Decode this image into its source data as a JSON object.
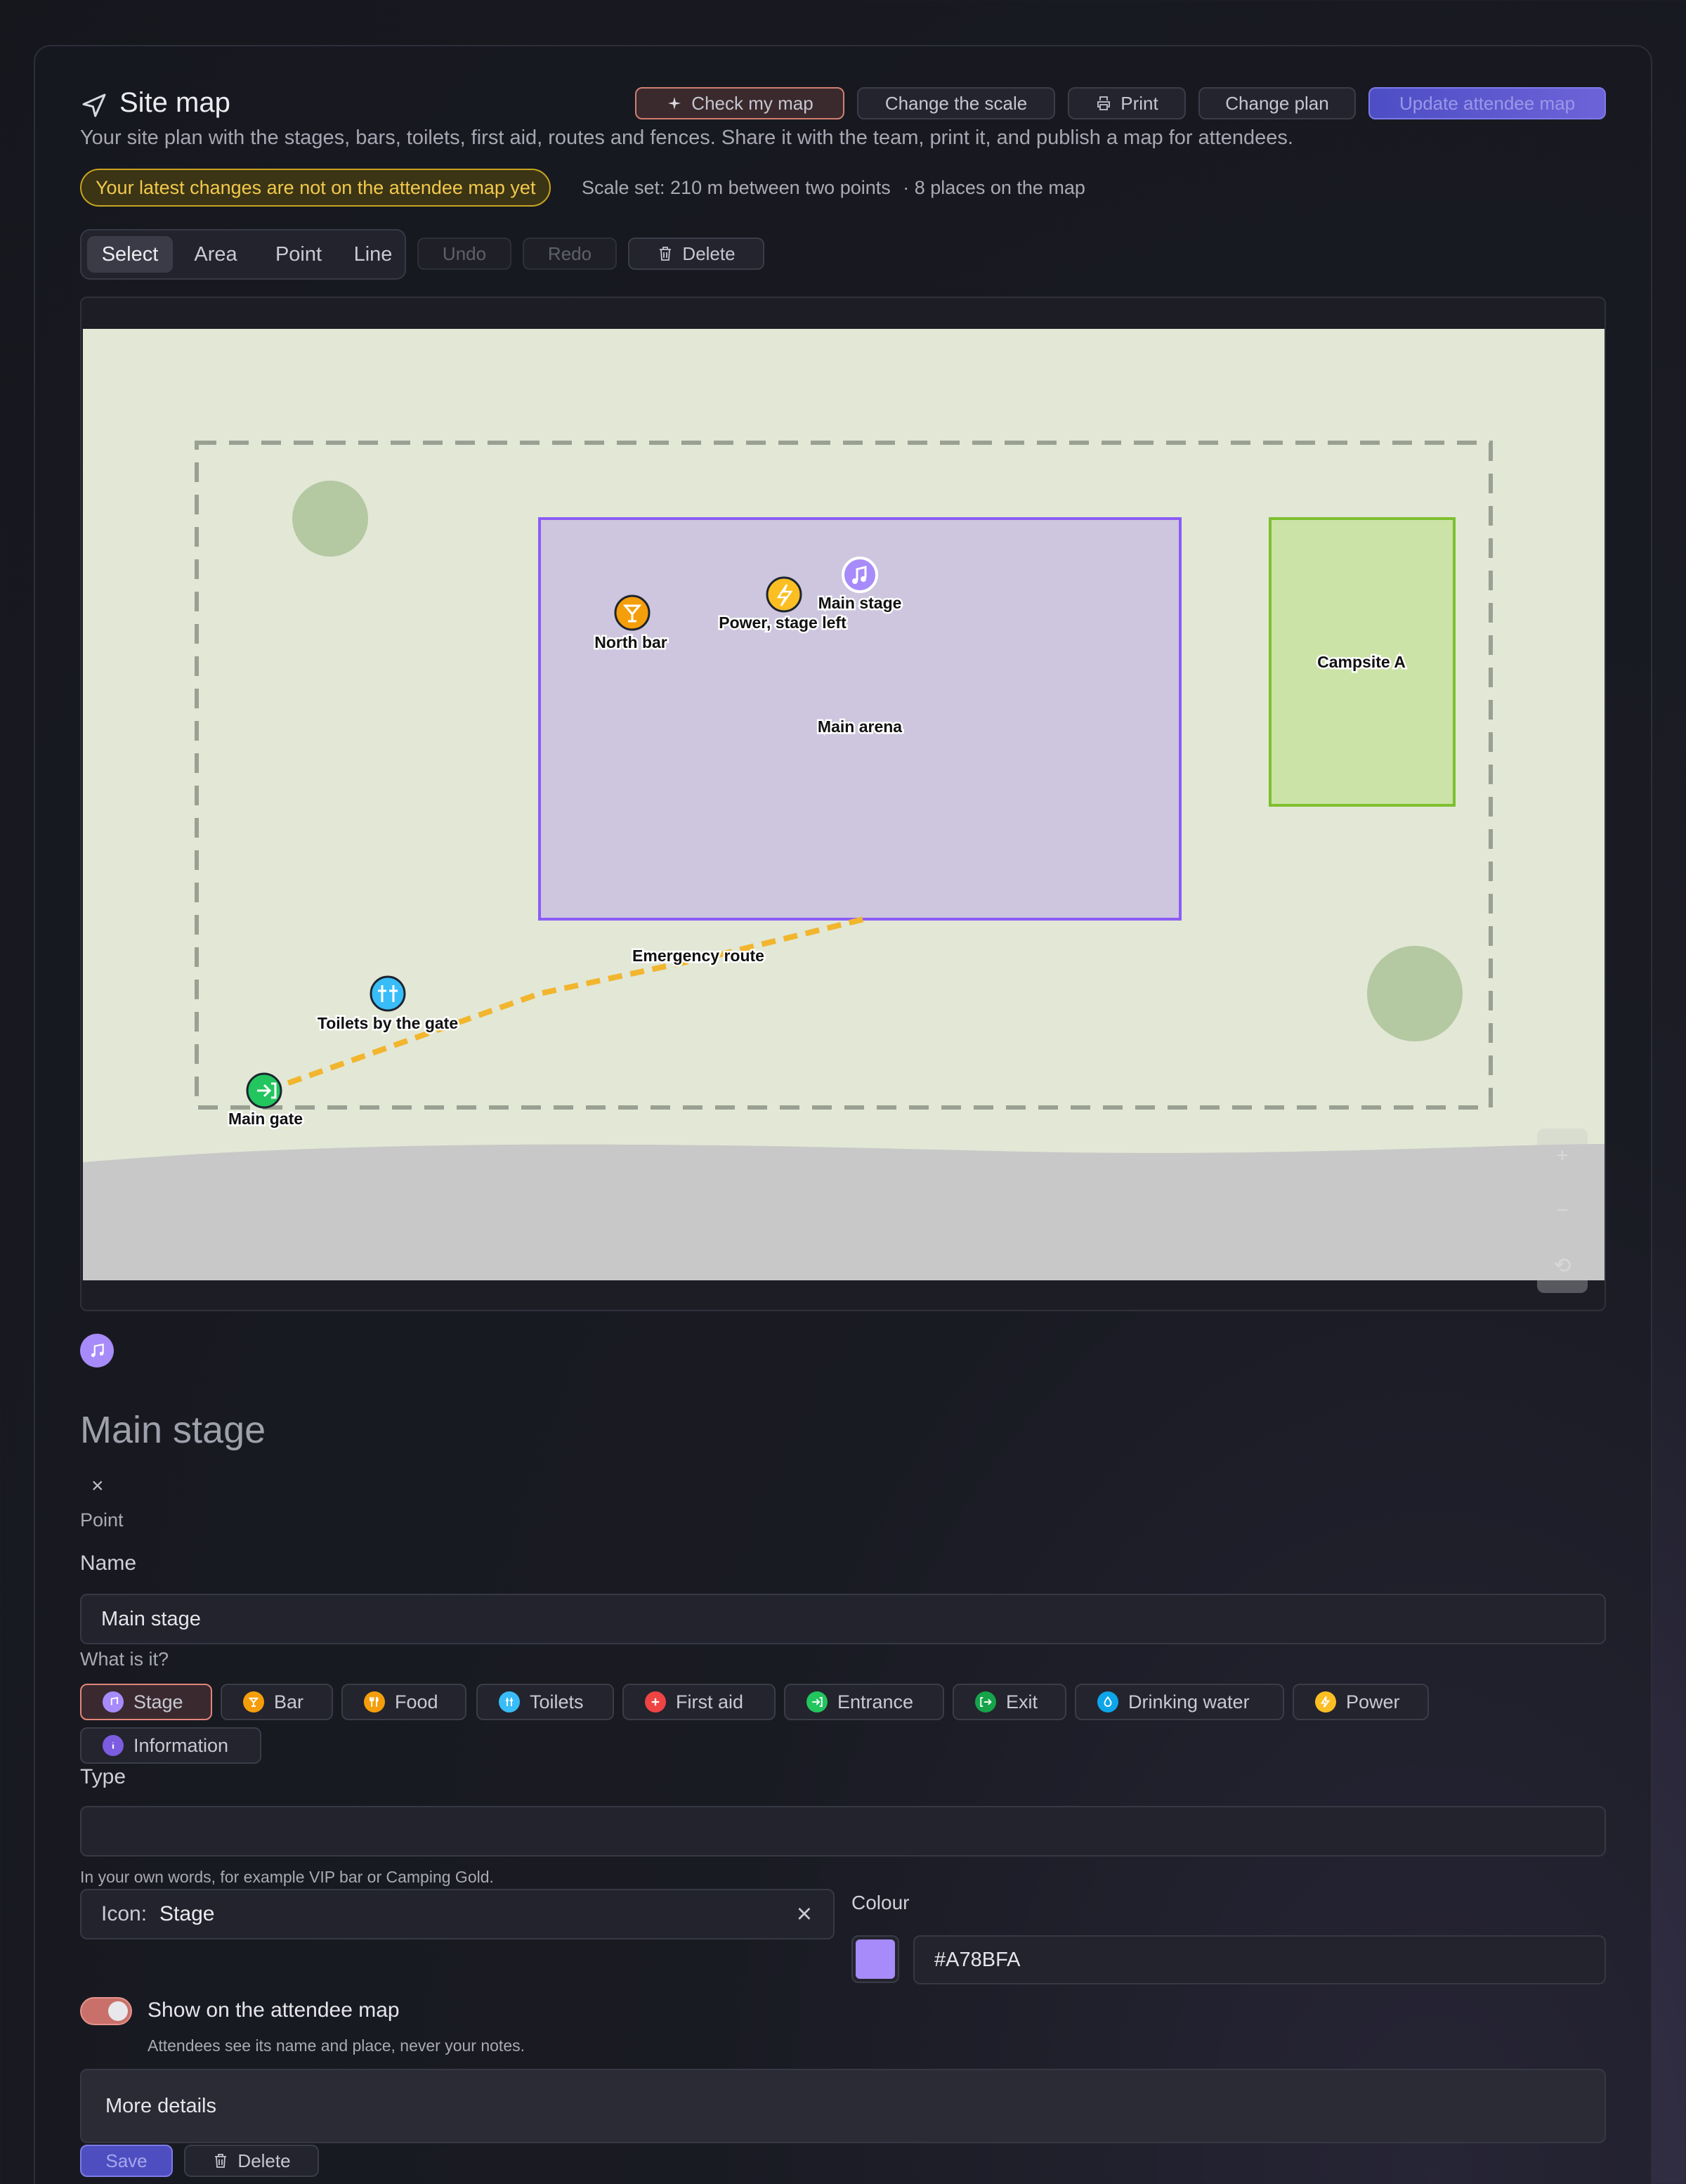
{
  "header": {
    "title": "Site map",
    "subtitle": "Your site plan with the stages, bars, toilets, first aid, routes and fences. Share it with the team, print it, and publish a map for attendees.",
    "buttons": {
      "check": "Check my map",
      "scale": "Change the scale",
      "print": "Print",
      "plan": "Change plan",
      "update": "Update attendee map"
    }
  },
  "status": {
    "badge": "Your latest changes are not on the attendee map yet",
    "scale": "Scale set: 210 m between two points",
    "places": "· 8 places on the map"
  },
  "toolbar": {
    "modes": [
      "Select",
      "Area",
      "Point",
      "Line"
    ],
    "active_mode": "Select",
    "undo": "Undo",
    "redo": "Redo",
    "delete": "Delete"
  },
  "map": {
    "places": {
      "main_arena": "Main arena",
      "campsite": "Campsite A",
      "north_bar": "North bar",
      "power": "Power, stage left",
      "main_stage": "Main stage",
      "emergency_route": "Emergency route",
      "toilets": "Toilets by the gate",
      "main_gate": "Main gate"
    },
    "zoom": {
      "in": "+",
      "out": "−",
      "reset": "⟲"
    }
  },
  "detail": {
    "title": "Main stage",
    "close": "×",
    "kind": "Point",
    "name_label": "Name",
    "name_value": "Main stage",
    "what_label": "What is it?",
    "types": [
      {
        "label": "Stage",
        "color": "#A78BFA",
        "icon": "music-icon"
      },
      {
        "label": "Bar",
        "color": "#F59E0B",
        "icon": "cocktail-icon"
      },
      {
        "label": "Food",
        "color": "#F59E0B",
        "icon": "fork-knife-icon"
      },
      {
        "label": "Toilets",
        "color": "#38BDF8",
        "icon": "toilets-icon"
      },
      {
        "label": "First aid",
        "color": "#EF4444",
        "icon": "plus-icon"
      },
      {
        "label": "Entrance",
        "color": "#22C55E",
        "icon": "enter-icon"
      },
      {
        "label": "Exit",
        "color": "#16A34A",
        "icon": "exit-icon"
      },
      {
        "label": "Drinking water",
        "color": "#0EA5E9",
        "icon": "droplet-icon"
      },
      {
        "label": "Power",
        "color": "#FBBF24",
        "icon": "bolt-icon"
      },
      {
        "label": "Information",
        "color": "#7C5CE0",
        "icon": "info-icon"
      }
    ],
    "selected_type": "Stage",
    "type_label": "Type",
    "type_value": "",
    "type_hint": "In your own words, for example VIP bar or Camping Gold.",
    "icon_label": "Icon:",
    "icon_value": "Stage",
    "colour_label": "Colour",
    "colour_value": "#A78BFA",
    "show_label": "Show on the attendee map",
    "show_hint": "Attendees see its name and place, never your notes.",
    "show_on": true,
    "more": "More details",
    "save": "Save",
    "delete": "Delete"
  },
  "colors": {
    "accent": "#5B5BD6",
    "stage": "#A78BFA",
    "bar": "#F59E0B",
    "power": "#FBBF24",
    "toilets": "#38BDF8",
    "entrance": "#22C55E",
    "route": "#F2B52E",
    "arena_border": "#8B5CF6",
    "campsite_border": "#7DC02F"
  }
}
